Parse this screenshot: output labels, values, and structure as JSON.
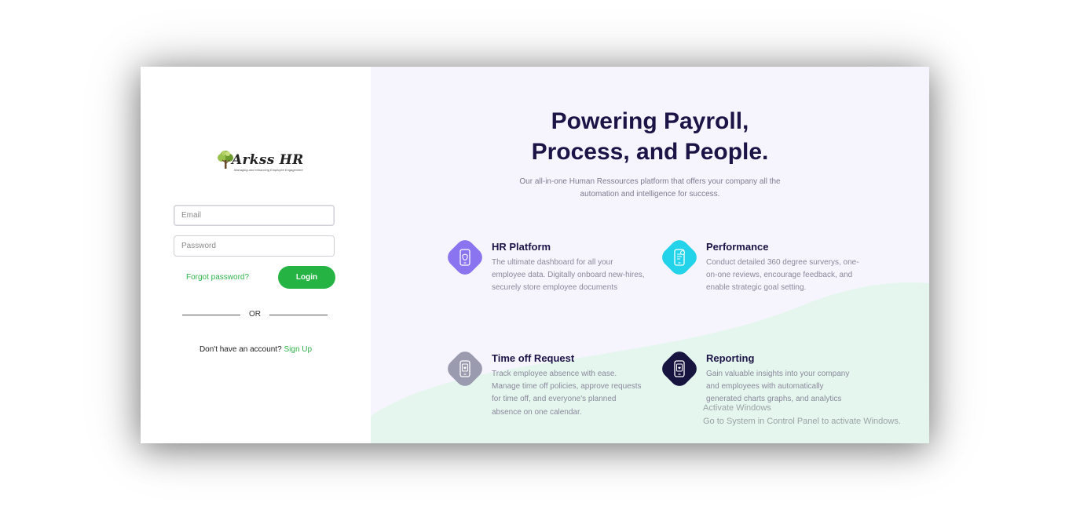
{
  "logo": {
    "name": "Arkss HR",
    "tagline": "Managing and enhancing Employee Engagement"
  },
  "login_form": {
    "email_placeholder": "Email",
    "password_placeholder": "Password",
    "forgot_password": "Forgot password?",
    "login_button": "Login",
    "or_divider": "OR",
    "no_account_text": "Don't have an account?",
    "signup_link": "Sign Up"
  },
  "hero": {
    "title_line1": "Powering Payroll,",
    "title_line2": "Process, and People.",
    "subtitle": "Our all-in-one Human Ressources platform that offers your company all the automation and intelligence for success."
  },
  "features": [
    {
      "title": "HR Platform",
      "description": "The ultimate dashboard for all your employee data. Digitally onboard new-hires, securely store employee documents",
      "icon": "phone-shield-icon",
      "color": "#8a74ef"
    },
    {
      "title": "Performance",
      "description": "Conduct detailed 360 degree surverys, one-on-one reviews, encourage feedback, and enable strategic goal setting.",
      "icon": "phone-checklist-icon",
      "color": "#22d3e9"
    },
    {
      "title": "Time off Request",
      "description": "Track employee absence with ease. Manage time off policies, approve requests for time off, and everyone's planned absence on one calendar.",
      "icon": "phone-heart-icon",
      "color": "#9b9bb0"
    },
    {
      "title": "Reporting",
      "description": "Gain valuable insights into your company and employees with automatically generated charts graphs, and analytics",
      "icon": "phone-heart-icon",
      "color": "#17143f"
    }
  ],
  "watermark": {
    "line1": "Activate Windows",
    "line2": "Go to System in Control Panel to activate Windows."
  },
  "colors": {
    "accent_green": "#25b444",
    "title_navy": "#1c1446",
    "right_background": "#f6f5fe",
    "wave_green": "#e5f6ee"
  }
}
